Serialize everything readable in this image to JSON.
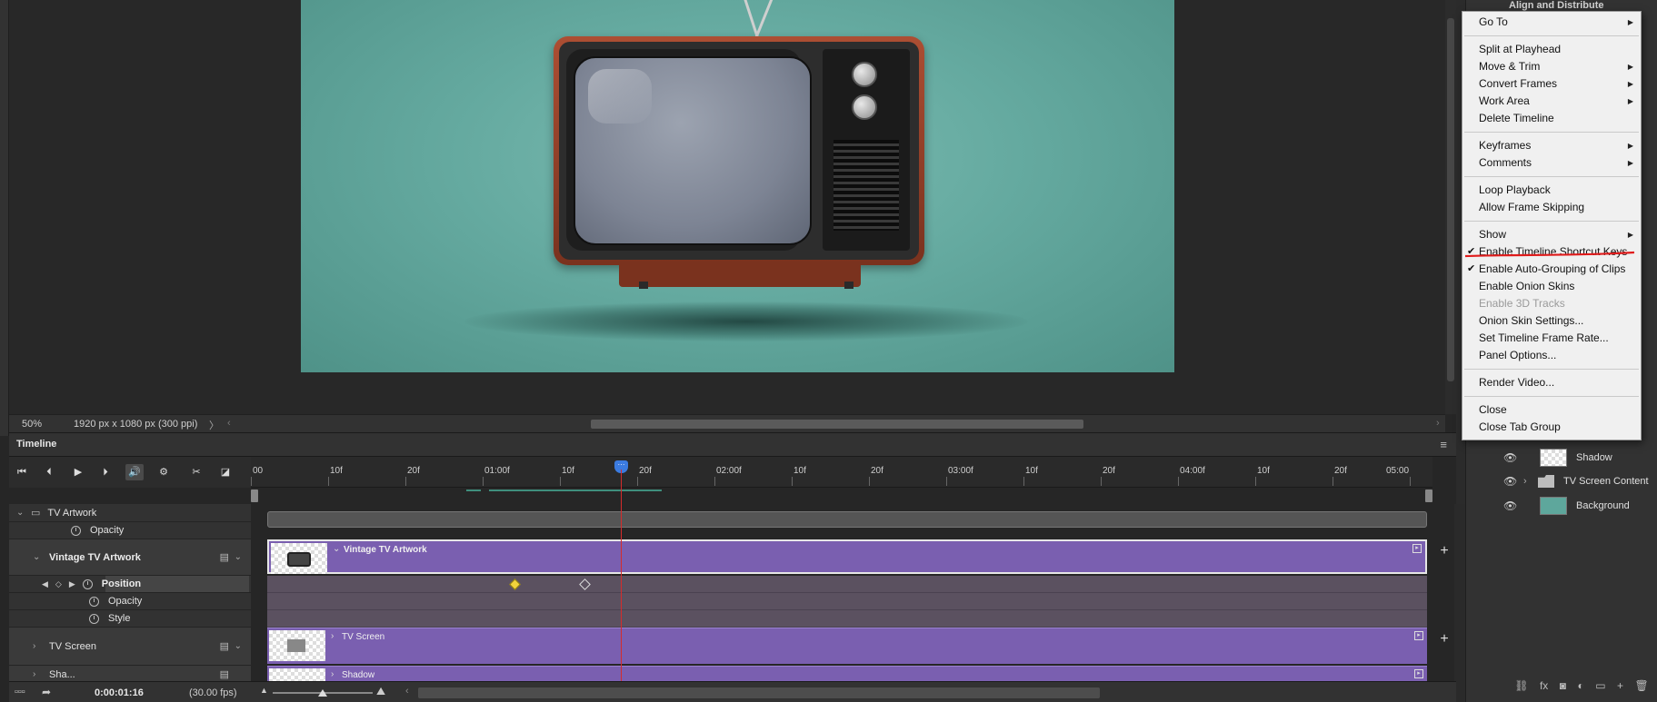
{
  "canvas": {
    "zoom": "50%",
    "doc_info": "1920 px x 1080 px (300 ppi)",
    "status_arrow": "〉",
    "scroll_left": "‹",
    "scroll_right": "›"
  },
  "timeline": {
    "tab_label": "Timeline",
    "menu_icon": "≡",
    "ruler_labels": [
      "00",
      "10f",
      "20f",
      "01:00f",
      "10f",
      "20f",
      "02:00f",
      "10f",
      "20f",
      "03:00f",
      "10f",
      "20f",
      "04:00f",
      "10f",
      "20f",
      "05:00"
    ],
    "tracks": {
      "tv_artwork": "TV Artwork",
      "tv_artwork_opacity": "Opacity",
      "vintage": "Vintage TV Artwork",
      "position": "Position",
      "opacity": "Opacity",
      "style": "Style",
      "tv_screen": "TV Screen",
      "shadow": "Sha..."
    },
    "clips": {
      "vintage": "Vintage TV Artwork",
      "tv_screen": "TV Screen",
      "shadow": "Shadow"
    },
    "timecode": "0:00:01:16",
    "fps": "(30.00 fps)",
    "add_symbol": "+",
    "playhead_marker": "···"
  },
  "layers": {
    "header": "Align and Distribute",
    "rows": [
      {
        "name": "Shadow"
      },
      {
        "name": "TV Screen Content"
      },
      {
        "name": "Background"
      }
    ],
    "footer_icons": [
      "link-icon",
      "fx-icon",
      "mask-icon",
      "adjustment-icon",
      "folder-icon",
      "new-layer-icon",
      "trash-icon"
    ],
    "footer_glyphs": [
      "⛓",
      "fx",
      "◙",
      "◐",
      "▭",
      "+",
      "🗑"
    ]
  },
  "context_menu": {
    "items": [
      {
        "label": "Go To",
        "submenu": true
      },
      {
        "sep": true
      },
      {
        "label": "Split at Playhead"
      },
      {
        "label": "Move & Trim",
        "submenu": true
      },
      {
        "label": "Convert Frames",
        "submenu": true
      },
      {
        "label": "Work Area",
        "submenu": true
      },
      {
        "label": "Delete Timeline"
      },
      {
        "sep": true
      },
      {
        "label": "Keyframes",
        "submenu": true
      },
      {
        "label": "Comments",
        "submenu": true
      },
      {
        "sep": true
      },
      {
        "label": "Loop Playback"
      },
      {
        "label": "Allow Frame Skipping"
      },
      {
        "sep": true
      },
      {
        "label": "Show",
        "submenu": true
      },
      {
        "label": "Enable Timeline Shortcut Keys",
        "checked": true
      },
      {
        "label": "Enable Auto-Grouping of Clips",
        "checked": true
      },
      {
        "label": "Enable Onion Skins"
      },
      {
        "label": "Enable 3D Tracks",
        "disabled": true
      },
      {
        "label": "Onion Skin Settings..."
      },
      {
        "label": "Set Timeline Frame Rate..."
      },
      {
        "label": "Panel Options..."
      },
      {
        "sep": true
      },
      {
        "label": "Render Video..."
      },
      {
        "sep": true
      },
      {
        "label": "Close"
      },
      {
        "label": "Close Tab Group"
      }
    ]
  },
  "colors": {
    "clip_purple": "#7a5fb0",
    "playhead_red": "#d62b2b",
    "playhead_blue": "#3b7be0",
    "annotation_red": "#e01b1b",
    "artboard_teal": "#65aaa0"
  }
}
